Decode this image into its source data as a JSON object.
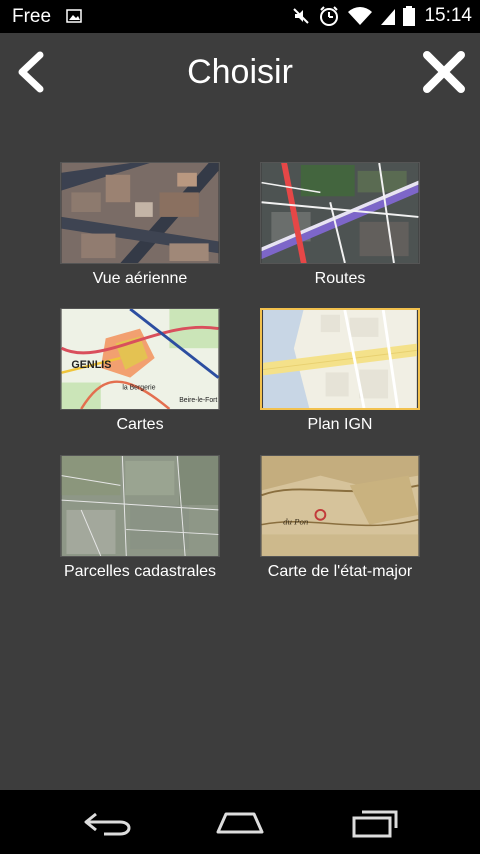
{
  "status": {
    "carrier": "Free",
    "time": "15:14",
    "icons": [
      "image-icon",
      "mute-icon",
      "alarm-icon",
      "wifi-icon",
      "signal-icon",
      "battery-icon"
    ]
  },
  "header": {
    "title": "Choisir",
    "back_icon": "chevron-left-icon",
    "close_icon": "close-icon"
  },
  "maps": [
    {
      "id": "aerial",
      "label": "Vue aérienne",
      "selected": false
    },
    {
      "id": "roads",
      "label": "Routes",
      "selected": false
    },
    {
      "id": "maps",
      "label": "Cartes",
      "selected": false
    },
    {
      "id": "ign",
      "label": "Plan IGN",
      "selected": true
    },
    {
      "id": "cadastre",
      "label": "Parcelles cadastrales",
      "selected": false
    },
    {
      "id": "etat-major",
      "label": "Carte de l'état-major",
      "selected": false
    }
  ],
  "thumb_text": {
    "cartes_town": "GENLIS",
    "cartes_place": "la Bergerie",
    "cartes_village": "Beire-le-Fort",
    "etatmajor_place": "du Pon"
  },
  "navigation": {
    "icons": [
      "back-nav-icon",
      "home-nav-icon",
      "recents-nav-icon"
    ]
  }
}
